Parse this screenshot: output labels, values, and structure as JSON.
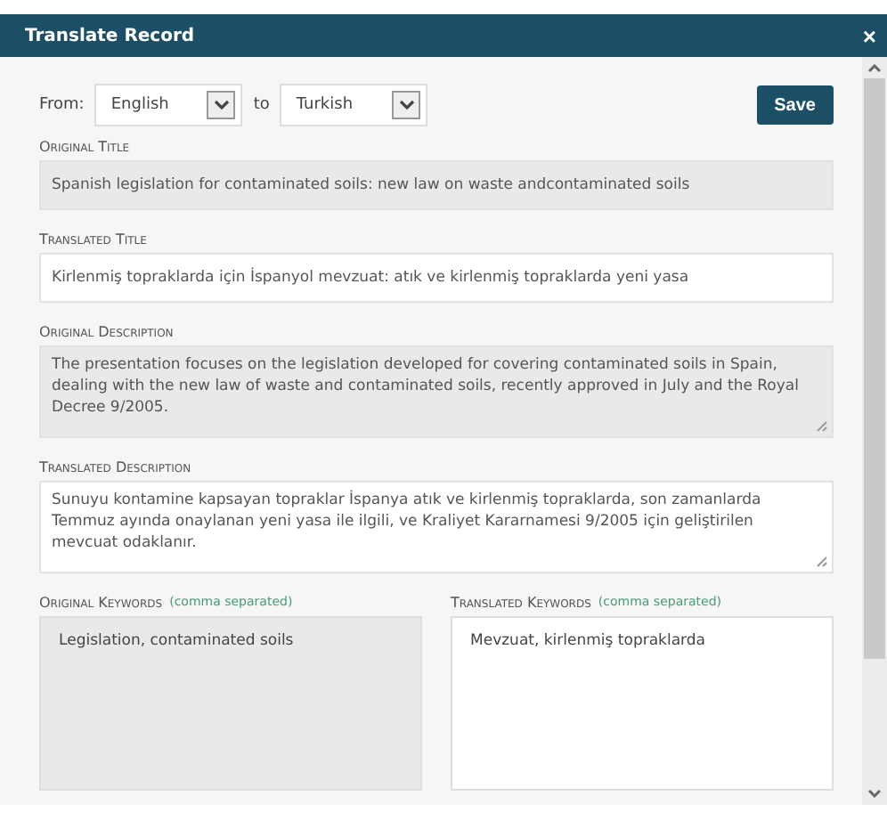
{
  "window": {
    "title": "Translate Record",
    "close": "×"
  },
  "languages": {
    "from_label": "From:",
    "from": "English",
    "to_label": "to",
    "to": "Turkish"
  },
  "save": "Save",
  "fields": [
    {
      "label": "Original Title",
      "kind": "line",
      "readonly": true,
      "value": "Spanish legislation for contaminated soils: new law on waste andcontaminated soils"
    },
    {
      "label": "Translated Title",
      "kind": "line",
      "readonly": false,
      "value": "Kirlenmiş topraklarda için İspanyol mevzuat: atık ve kirlenmiş topraklarda yeni yasa"
    },
    {
      "label": "Original Description",
      "kind": "area",
      "readonly": true,
      "value": "The presentation focuses on the legislation developed for covering contaminated soils in Spain, dealing with the new law of waste and contaminated soils, recently approved in July and the Royal Decree 9/2005."
    },
    {
      "label": "Translated Description",
      "kind": "area",
      "readonly": false,
      "value": "Sunuyu kontamine kapsayan topraklar İspanya atık ve kirlenmiş topraklarda, son zamanlarda Temmuz ayında onaylanan yeni yasa ile ilgili, ve Kraliyet Kararnamesi 9/2005 için geliştirilen mevcuat odaklanır."
    }
  ],
  "keywords": [
    {
      "label": "Original Keywords",
      "hint": "(comma separated)",
      "readonly": true,
      "value": "Legislation, contaminated soils"
    },
    {
      "label": "Translated Keywords",
      "hint": "(comma separated)",
      "readonly": false,
      "value": "Mevzuat, kirlenmiş topraklarda"
    }
  ]
}
